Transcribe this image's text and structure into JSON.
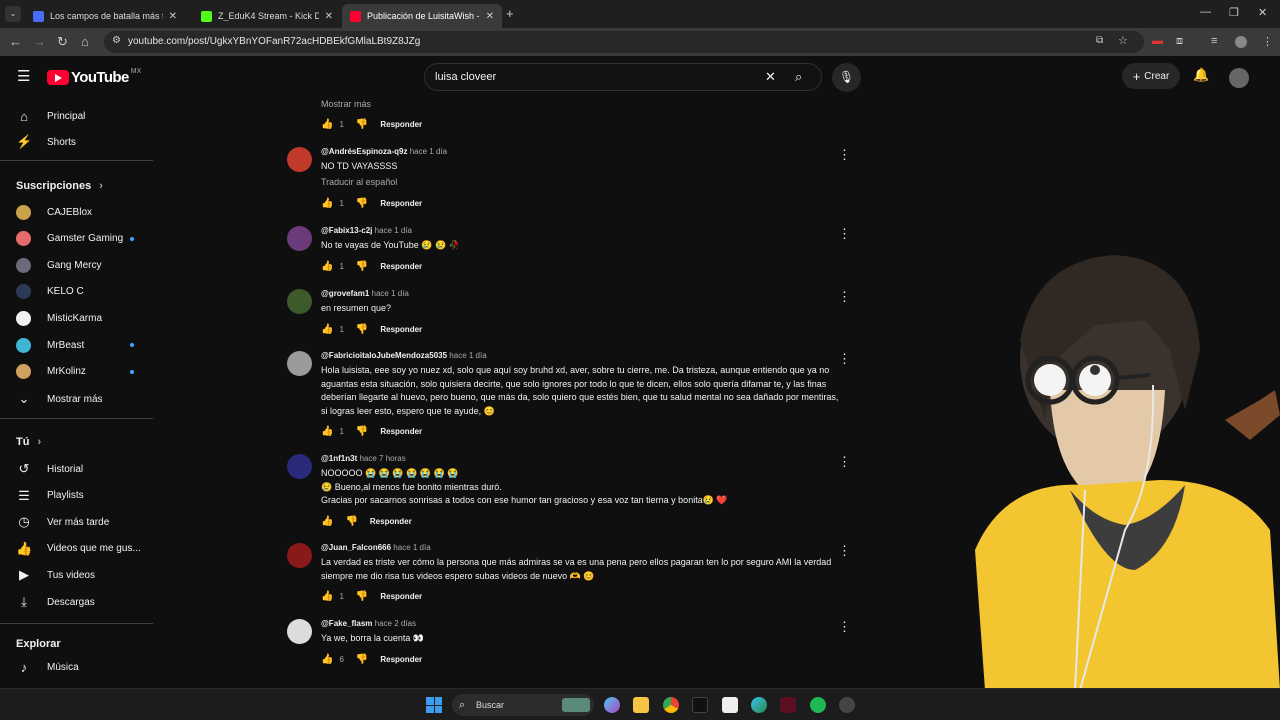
{
  "browser": {
    "tabs": [
      {
        "label": "Los campos de batalla más fue",
        "color": "#4a6cf7",
        "active": false
      },
      {
        "label": "Z_EduK4 Stream - Kick Dashbo",
        "color": "#53fc18",
        "active": false
      },
      {
        "label": "Publicación de LuisitaWish - Yo",
        "color": "#ff0033",
        "active": true
      }
    ],
    "new_tab": "+",
    "url": "youtube.com/post/UgkxYBnYOFanR72acHDBEkfGMlaLBt9Z8JZg"
  },
  "youtube": {
    "logo_text": "YouTube",
    "country": "MX",
    "search_value": "luisa cloveer",
    "create_label": "Crear"
  },
  "sidebar": {
    "main": [
      {
        "label": "Principal",
        "icon": "home-icon",
        "glyph": "⌂"
      },
      {
        "label": "Shorts",
        "icon": "shorts-icon",
        "glyph": "⚡"
      }
    ],
    "subs_heading": "Suscripciones",
    "subs": [
      {
        "label": "CAJEBlox",
        "color": "#c9a24a",
        "dot": false
      },
      {
        "label": "Gamster Gaming",
        "color": "#e86b6b",
        "dot": true
      },
      {
        "label": "Gang Mercy",
        "color": "#6a6a7a",
        "dot": false
      },
      {
        "label": "KELO C",
        "color": "#2b3a55",
        "dot": false
      },
      {
        "label": "MisticKarma",
        "color": "#f1f1f1",
        "dot": false
      },
      {
        "label": "MrBeast",
        "color": "#3fb6d4",
        "dot": true
      },
      {
        "label": "MrKolinz",
        "color": "#d0a060",
        "dot": true
      }
    ],
    "more_label": "Mostrar más",
    "you_heading": "Tú",
    "you_items": [
      {
        "label": "Historial",
        "icon": "history-icon",
        "glyph": "↺"
      },
      {
        "label": "Playlists",
        "icon": "playlists-icon",
        "glyph": "☰"
      },
      {
        "label": "Ver más tarde",
        "icon": "watch-later-icon",
        "glyph": "◷"
      },
      {
        "label": "Videos que me gus...",
        "icon": "liked-icon",
        "glyph": "👍"
      },
      {
        "label": "Tus videos",
        "icon": "your-videos-icon",
        "glyph": "▶"
      },
      {
        "label": "Descargas",
        "icon": "downloads-icon",
        "glyph": "⤓"
      }
    ],
    "explore_heading": "Explorar",
    "explore_items": [
      {
        "label": "Música",
        "icon": "music-icon",
        "glyph": "♪"
      }
    ]
  },
  "comments_top": {
    "show_more": "Mostrar más",
    "likes": "1",
    "reply": "Responder"
  },
  "comments": [
    {
      "author": "@AndrésEspinoza-q9z",
      "time": "hace 1 día",
      "lines": [
        "NO TD VAYASSSS"
      ],
      "translate": "Traducir al español",
      "likes": "1",
      "reply": "Responder",
      "color": "#c0392b"
    },
    {
      "author": "@Fabix13-c2j",
      "time": "hace 1 día",
      "lines": [
        "No te vayas de YouTube 😢 😢 🥀"
      ],
      "translate": "",
      "likes": "1",
      "reply": "Responder",
      "color": "#6b3a7a"
    },
    {
      "author": "@grovefam1",
      "time": "hace 1 día",
      "lines": [
        "en resumen que?"
      ],
      "translate": "",
      "likes": "1",
      "reply": "Responder",
      "color": "#3d5a2a"
    },
    {
      "author": "@FabricioitaloJubeMendoza5035",
      "time": "hace 1 día",
      "lines": [
        "Hola luisista, eee soy yo nuez xd, solo que aquí soy bruhd xd, aver, sobre tu cierre, me. Da tristeza, aunque entiendo que ya no",
        "aguantas esta situación, solo quisiera decirte, que solo ignores por todo lo que te dicen, ellos solo quería difamar te, y las finas",
        "deberían llegarte al huevo, pero bueno, que más da, solo quiero que estés bien, que tu salud mental no sea dañado por mentiras,",
        "si logras leer esto, espero que te ayude, 😊"
      ],
      "translate": "",
      "likes": "1",
      "reply": "Responder",
      "color": "#9a9a9a"
    },
    {
      "author": "@1nf1n3t",
      "time": "hace 7 horas",
      "lines": [
        "NOOOOO 😭 😭 😭 😭 😭 😭 😭",
        "😢 Bueno,al menos fue bonito mientras duró.",
        "Gracias por sacarnos sonrisas a todos con ese humor tan gracioso y esa voz tan tierna y bonita😢 ❤️"
      ],
      "translate": "",
      "likes": "",
      "reply": "Responder",
      "color": "#2a2a7a"
    },
    {
      "author": "@Juan_Falcon666",
      "time": "hace 1 día",
      "lines": [
        "La verdad es triste ver cómo la persona que más admiras se va es una pena pero ellos pagaran ten lo por seguro AMI la verdad",
        "siempre me dio risa tus videos espero subas videos de nuevo 🫶 😊"
      ],
      "translate": "",
      "likes": "1",
      "reply": "Responder",
      "color": "#8a1a1a"
    },
    {
      "author": "@Fake_flasm",
      "time": "hace 2 días",
      "lines": [
        "Ya we, borra la cuenta 👀"
      ],
      "translate": "",
      "likes": "6",
      "reply": "Responder",
      "color": "#dcdcdc"
    }
  ],
  "taskbar": {
    "search_label": "Buscar"
  }
}
